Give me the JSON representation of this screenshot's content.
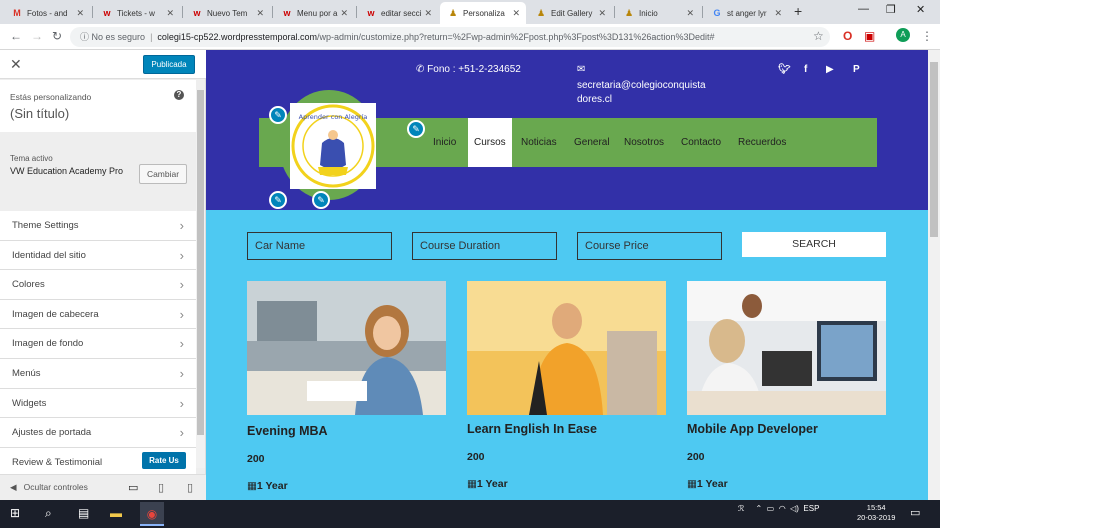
{
  "browser": {
    "tabs": [
      {
        "label": "Fotos - and",
        "favicon": "gmail-icon"
      },
      {
        "label": "Tickets - w",
        "favicon": "w-icon"
      },
      {
        "label": "Nuevo Tem",
        "favicon": "w-icon"
      },
      {
        "label": "Menu por a",
        "favicon": "w-icon"
      },
      {
        "label": "editar secci",
        "favicon": "w-icon"
      },
      {
        "label": "Personaliza",
        "favicon": "customizer-icon"
      },
      {
        "label": "Edit Gallery",
        "favicon": "customizer-icon"
      },
      {
        "label": "Inicio",
        "favicon": "customizer-icon"
      },
      {
        "label": "st anger lyr",
        "favicon": "google-icon"
      }
    ],
    "security_label": "No es seguro",
    "url_host": "colegi15-cp522.wordpresstemporal.com",
    "url_path": "/wp-admin/customize.php?return=%2Fwp-admin%2Fpost.php%3Fpost%3D131%26action%3Dedit#",
    "profile_initial": "A"
  },
  "customizer": {
    "publish_label": "Publicada",
    "customizing_label": "Estás personalizando",
    "site_title": "(Sin título)",
    "active_theme_label": "Tema activo",
    "theme_name": "VW Education Academy Pro",
    "change_label": "Cambiar",
    "menu_items": [
      "Theme Settings",
      "Identidad del sitio",
      "Colores",
      "Imagen de cabecera",
      "Imagen de fondo",
      "Menús",
      "Widgets",
      "Ajustes de portada",
      "Review & Testimonial"
    ],
    "rate_us_label": "Rate Us",
    "hide_controls_label": "Ocultar controles"
  },
  "site": {
    "phone": "Fono : +51-2-234652",
    "email_line1": "secretaria@colegioconquista",
    "email_line2": "dores.cl",
    "nav": [
      "Inicio",
      "Cursos",
      "Noticias",
      "General",
      "Nosotros",
      "Contacto",
      "Recuerdos"
    ],
    "active_nav": "Cursos",
    "logo_text": "Aprender con Alegría",
    "search": {
      "car_name_placeholder": "Car Name",
      "duration_placeholder": "Course Duration",
      "price_placeholder": "Course Price",
      "button_label": "SEARCH"
    },
    "courses": [
      {
        "title": "Evening MBA",
        "price": "200",
        "duration": "1 Year"
      },
      {
        "title": "Learn English In Ease",
        "price": "200",
        "duration": "1 Year"
      },
      {
        "title": "Mobile App Developer",
        "price": "200",
        "duration": "1 Year"
      }
    ]
  },
  "taskbar": {
    "lang": "ESP",
    "time": "15:54",
    "date": "20-03-2019"
  },
  "colors": {
    "header_bg": "#3230a8",
    "nav_bg": "#69a84f",
    "content_bg": "#4ec9f2",
    "publish_blue": "#0085ba"
  }
}
